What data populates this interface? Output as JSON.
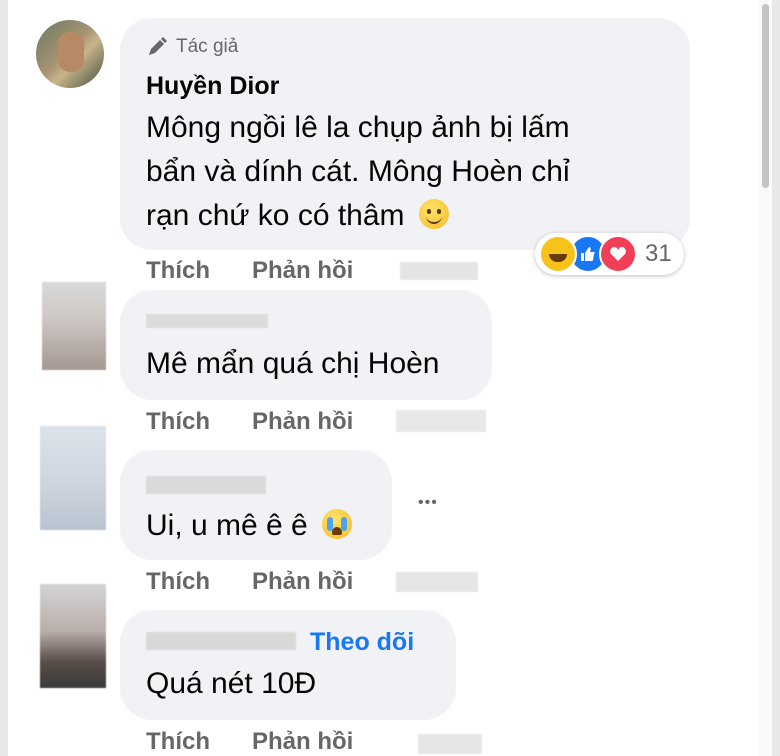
{
  "comments": [
    {
      "author_tag": "Tác giả",
      "name": "Huyền Dior",
      "text_lines": [
        "Mông ngồi lê la chụp ảnh bị lấm",
        "bẩn và dính cát. Mông Hoèn chỉ",
        "rạn chứ ko có thâm"
      ],
      "reactions": {
        "icons": [
          "haha-icon",
          "like-icon",
          "love-icon"
        ],
        "count": "31"
      },
      "like_label": "Thích",
      "reply_label": "Phản hồi"
    },
    {
      "text": "Mê mẩn quá chị Hoèn",
      "like_label": "Thích",
      "reply_label": "Phản hồi"
    },
    {
      "text": "Ui, u mê ê ê",
      "more_label": "•••",
      "like_label": "Thích",
      "reply_label": "Phản hồi"
    },
    {
      "follow_label": "Theo dõi",
      "text": "Quá nét 10Đ",
      "like_label": "Thích",
      "reply_label": "Phản hồi"
    }
  ],
  "colors": {
    "bubble": "#f0f2f5",
    "link": "#1877f2",
    "muted": "#65676b",
    "text": "#050505"
  }
}
